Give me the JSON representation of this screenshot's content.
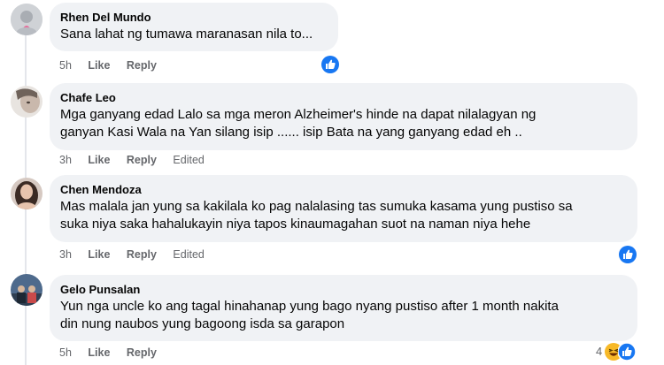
{
  "comments": [
    {
      "author": "Rhen Del Mundo",
      "text_lines": [
        "Sana lahat ng tumawa maranasan nila to..."
      ],
      "time": "5h",
      "like_label": "Like",
      "reply_label": "Reply",
      "edited_label": "",
      "reactions": [
        "like"
      ],
      "reaction_count": ""
    },
    {
      "author": "Chafe Leo",
      "text_lines": [
        "Mga ganyang edad Lalo sa mga meron Alzheimer's hinde na dapat nilalagyan ng",
        "ganyan Kasi Wala na Yan silang isip ...... isip Bata na yang ganyang edad eh .."
      ],
      "time": "3h",
      "like_label": "Like",
      "reply_label": "Reply",
      "edited_label": "Edited",
      "reactions": [],
      "reaction_count": ""
    },
    {
      "author": "Chen Mendoza",
      "text_lines": [
        "Mas malala jan yung sa kakilala ko pag nalalasing tas sumuka kasama yung pustiso sa",
        "suka niya saka hahalukayin niya tapos kinaumagahan suot na naman niya hehe"
      ],
      "time": "3h",
      "like_label": "Like",
      "reply_label": "Reply",
      "edited_label": "Edited",
      "reactions": [
        "like"
      ],
      "reaction_count": ""
    },
    {
      "author": "Gelo Punsalan",
      "text_lines": [
        "Yun nga uncle ko ang tagal hinahanap yung bago nyang pustiso after 1 month nakita",
        "din nung naubos yung bagoong isda sa garapon"
      ],
      "time": "5h",
      "like_label": "Like",
      "reply_label": "Reply",
      "edited_label": "",
      "reactions": [
        "haha",
        "like"
      ],
      "reaction_count": "4"
    }
  ],
  "colors": {
    "bubble": "#f0f2f5",
    "secondary_text": "#65676b",
    "like_blue": "#1877f2",
    "haha_yellow": "#f7b928"
  }
}
